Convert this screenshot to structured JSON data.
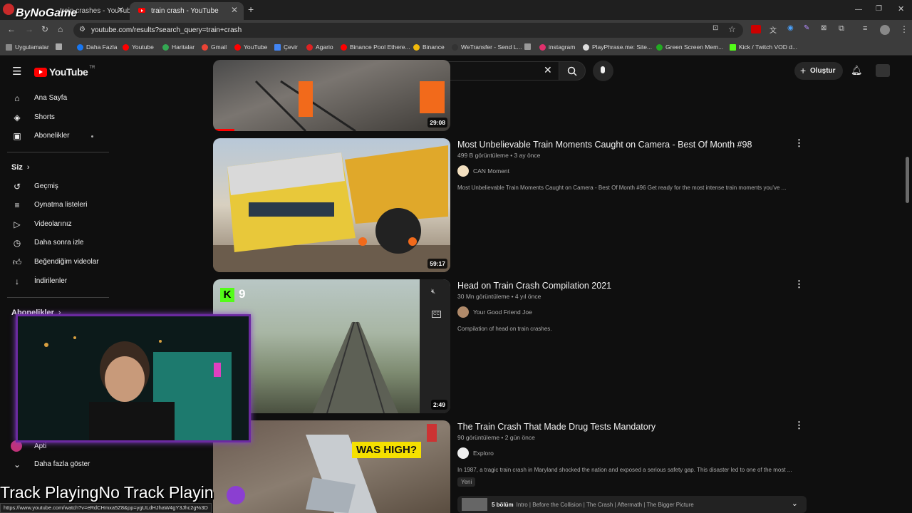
{
  "browser": {
    "tabs": [
      {
        "title": "train crashes - YouTube",
        "prefix": "a r tr"
      },
      {
        "title": "train crash - YouTube"
      }
    ],
    "new_tab": "+",
    "url": "youtube.com/results?search_query=train+crash",
    "bookmarks": [
      "Uygulamalar",
      "Daha Fazla",
      "Youtube",
      "Haritalar",
      "Gmail",
      "YouTube",
      "Çevir",
      "Agario",
      "Binance Pool Ethere...",
      "Binance",
      "WeTransfer - Send L...",
      "instagram",
      "PlayPhrase.me: Site...",
      "Green Screen Mem...",
      "Kick / Twitch VOD d..."
    ]
  },
  "watermark": "ByNoGame",
  "header": {
    "logo": "YouTube",
    "logo_sup": "TR",
    "search_value": "train crash",
    "create_label": "Oluştur"
  },
  "sidebar": {
    "items": [
      {
        "label": "Ana Sayfa",
        "icon": "home-icon"
      },
      {
        "label": "Shorts",
        "icon": "shorts-icon"
      },
      {
        "label": "Abonelikler",
        "icon": "subscriptions-icon"
      }
    ],
    "you_title": "Siz",
    "you_items": [
      {
        "label": "Geçmiş",
        "icon": "history-icon"
      },
      {
        "label": "Oynatma listeleri",
        "icon": "playlist-icon"
      },
      {
        "label": "Videolarınız",
        "icon": "your-videos-icon"
      },
      {
        "label": "Daha sonra izle",
        "icon": "watch-later-icon"
      },
      {
        "label": "Beğendiğim videolar",
        "icon": "like-icon"
      },
      {
        "label": "İndirilenler",
        "icon": "download-icon"
      }
    ],
    "subs_title": "Abonelikler",
    "partial_item": "Apti",
    "show_more": "Daha fazla göster"
  },
  "videos": [
    {
      "duration": "29:08"
    },
    {
      "title": "Most Unbelievable Train Moments Caught on Camera - Best Of Month #98",
      "meta": "499 B görüntüleme • 3 ay önce",
      "channel": "CAN Moment",
      "desc": "Most Unbelievable Train Moments Caught on Camera - Best Of Month #96 Get ready for the most intense train moments you've ...",
      "duration": "59:17"
    },
    {
      "title": "Head on Train Crash Compilation 2021",
      "meta": "30 Mn görüntüleme • 4 yıl önce",
      "channel": "Your Good Friend Joe",
      "desc": "Compilation of head on train crashes.",
      "duration": "2:49",
      "overlay_num": "9"
    },
    {
      "title": "The Train Crash That Made Drug Tests Mandatory",
      "meta": "90 görüntüleme • 2 gün önce",
      "channel": "Exploro",
      "desc": "In 1987, a tragic train crash in Maryland shocked the nation and exposed a serious safety gap. This disaster led to one of the most ...",
      "badge": "Yeni",
      "thumb_text": "WAS HIGH?",
      "chapters_count": "5 bölüm",
      "chapters": "Intro | Before the Collision | The Crash | Aftermath | The Bigger Picture"
    }
  ],
  "stream_overlay": {
    "now_playing": "Track PlayingNo Track Playin",
    "status_url": "https://www.youtube.com/watch?v=eRdCHmxa5Z8&pp=ygULdHJhaW4gY3Jhc2g%3D"
  },
  "colors": {
    "accent": "#ff0000",
    "bg": "#0f0f0f",
    "webcam_border": "#6b2aa0"
  }
}
